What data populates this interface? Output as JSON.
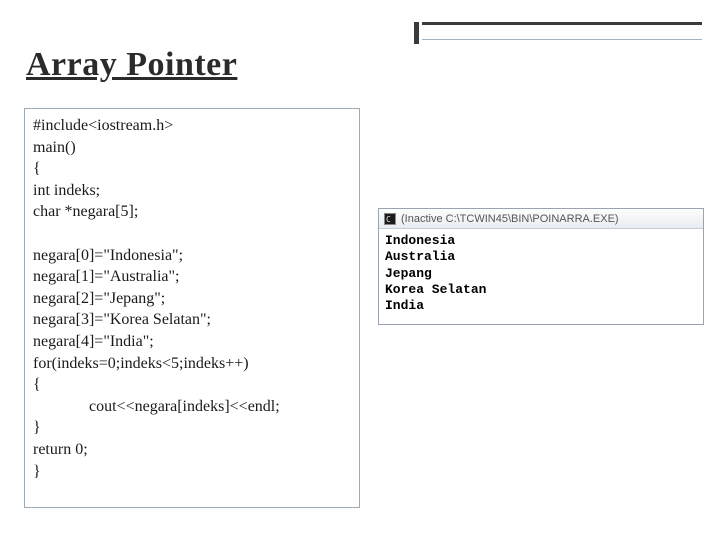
{
  "title": "Array Pointer",
  "code": "#include<iostream.h>\nmain()\n{\nint indeks;\nchar *negara[5];\n\nnegara[0]=\"Indonesia\";\nnegara[1]=\"Australia\";\nnegara[2]=\"Jepang\";\nnegara[3]=\"Korea Selatan\";\nnegara[4]=\"India\";\nfor(indeks=0;indeks<5;indeks++)\n{\n              cout<<negara[indeks]<<endl;\n}\nreturn 0;\n}",
  "console": {
    "title": "(Inactive C:\\TCWIN45\\BIN\\POINARRA.EXE)",
    "output": "Indonesia\nAustralia\nJepang\nKorea Selatan\nIndia"
  }
}
